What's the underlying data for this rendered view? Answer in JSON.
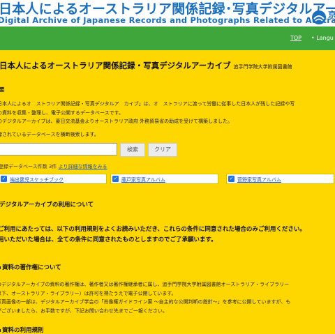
{
  "banner": {
    "title_ja": "日本人によるオーストラリア関係記録･写真デジタルアーカイブ",
    "subtitle_en": "Digital Archive of Japanese Records and Photographs Related to Australia",
    "logo_text": "京"
  },
  "nav": {
    "top_label": "TOP",
    "lang_label": "• Langu"
  },
  "page": {
    "title": "日本人によるオーストラリア関係記録・写真デジタルアーカイブ",
    "title_sub": "追手門学院大学附属図書館"
  },
  "overview": {
    "heading": "要",
    "lines": [
      "日本人によるオ　ストラリア関係記録・写真デジタルア　カイブ」は、オ　ストラリアに渡って労働に従事した日本人が残した記録や写",
      "の資料を収集・整理し、電子公開するデータベースです。",
      "のデジタルアーカイブは、豪日交流基金よりオーストラリア政府 外務貿易省の助成を受けて構築しました。"
    ],
    "search_hint": "録されているデータベースを横断検索します。"
  },
  "search": {
    "input_value": "",
    "search_button": "検索",
    "clear_button": "クリア"
  },
  "records_info": {
    "text": "登録データベース件数 3件",
    "link": "より詳細な情報をみる"
  },
  "databases": [
    {
      "label": "端出健児スケッチブック",
      "checked": "✓"
    },
    {
      "label": "藤戸家写真アルバム",
      "checked": "✓"
    },
    {
      "label": "菅野家写真アルバム",
      "checked": "✓"
    }
  ],
  "usage": {
    "heading": "デジタルアーカイブの利用について",
    "terms_line1": "ご利用にあたっては、以下の利用規則をよくお読みいただき、これらの条件に同意された場合のみご利用ください。",
    "terms_line2": "用いただいた場合は、全ての条件に同意されたものとしますのでご了承願います。"
  },
  "copyright": {
    "heading": "資料の著作権について",
    "lines": [
      "のデジタルアーカイブの資料の著作権は、著作者又は著作権継承者に属し、追手門学院大学附属図書館オーストラリア・ライブラリー",
      "以下、オーストラリア・ライブラリー）は許可を得たうえで電子公開しています。",
      "写真画像の一部は、デジタルアーカイブ学会の「肖像権ガイドライン案 〜自主的な公開判断の指針〜」を参考に公開していますが、も",
      "がございましたら、お手数ですが、下記お問い合わせ先までご一報ください。"
    ]
  },
  "rules": {
    "heading": "資料の利用規則"
  },
  "colors": {
    "background": "#ffd700",
    "nav_green": "#3fa63c",
    "banner_blue": "#1b6fbf",
    "link_blue": "#1a4fb3"
  }
}
